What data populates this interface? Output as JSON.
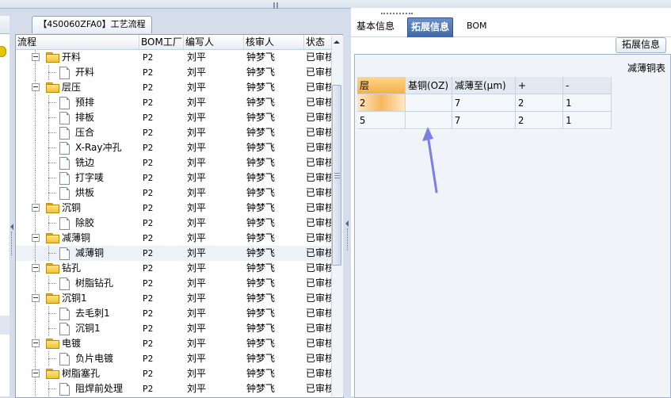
{
  "tree_tab": {
    "title": "【4S0060ZFA0】工艺流程"
  },
  "tree_grid": {
    "columns": [
      {
        "label": "流程"
      },
      {
        "label": "BOM工厂"
      },
      {
        "label": "编写人"
      },
      {
        "label": "核审人"
      },
      {
        "label": "状态"
      }
    ],
    "rows": [
      {
        "level": 0,
        "type": "folder",
        "name": "开料",
        "bom": "P2",
        "writer": "刘平",
        "reviewer": "钟梦飞",
        "status": "已审核"
      },
      {
        "level": 1,
        "type": "doc",
        "name": "开料",
        "bom": "P2",
        "writer": "刘平",
        "reviewer": "钟梦飞",
        "status": "已审核"
      },
      {
        "level": 0,
        "type": "folder",
        "name": "层压",
        "bom": "P2",
        "writer": "刘平",
        "reviewer": "钟梦飞",
        "status": "已审核"
      },
      {
        "level": 1,
        "type": "doc",
        "name": "预排",
        "bom": "P2",
        "writer": "刘平",
        "reviewer": "钟梦飞",
        "status": "已审核"
      },
      {
        "level": 1,
        "type": "doc",
        "name": "排板",
        "bom": "P2",
        "writer": "刘平",
        "reviewer": "钟梦飞",
        "status": "已审核"
      },
      {
        "level": 1,
        "type": "doc",
        "name": "压合",
        "bom": "P2",
        "writer": "刘平",
        "reviewer": "钟梦飞",
        "status": "已审核"
      },
      {
        "level": 1,
        "type": "doc",
        "name": "X-Ray冲孔",
        "bom": "P2",
        "writer": "刘平",
        "reviewer": "钟梦飞",
        "status": "已审核"
      },
      {
        "level": 1,
        "type": "doc",
        "name": "铣边",
        "bom": "P2",
        "writer": "刘平",
        "reviewer": "钟梦飞",
        "status": "已审核"
      },
      {
        "level": 1,
        "type": "doc",
        "name": "打字唛",
        "bom": "P2",
        "writer": "刘平",
        "reviewer": "钟梦飞",
        "status": "已审核"
      },
      {
        "level": 1,
        "type": "doc",
        "name": "烘板",
        "bom": "P2",
        "writer": "刘平",
        "reviewer": "钟梦飞",
        "status": "已审核"
      },
      {
        "level": 0,
        "type": "folder",
        "name": "沉铜",
        "bom": "P2",
        "writer": "刘平",
        "reviewer": "钟梦飞",
        "status": "已审核"
      },
      {
        "level": 1,
        "type": "doc",
        "name": "除胶",
        "bom": "P2",
        "writer": "刘平",
        "reviewer": "钟梦飞",
        "status": "已审核"
      },
      {
        "level": 0,
        "type": "folder",
        "name": "减薄铜",
        "bom": "P2",
        "writer": "刘平",
        "reviewer": "钟梦飞",
        "status": "已审核"
      },
      {
        "level": 1,
        "type": "doc",
        "name": "减薄铜",
        "bom": "P2",
        "writer": "刘平",
        "reviewer": "钟梦飞",
        "status": "已审核",
        "selected": true
      },
      {
        "level": 0,
        "type": "folder",
        "name": "钻孔",
        "bom": "P2",
        "writer": "刘平",
        "reviewer": "钟梦飞",
        "status": "已审核"
      },
      {
        "level": 1,
        "type": "doc",
        "name": "树脂钻孔",
        "bom": "P2",
        "writer": "刘平",
        "reviewer": "钟梦飞",
        "status": "已审核"
      },
      {
        "level": 0,
        "type": "folder",
        "name": "沉铜1",
        "bom": "P2",
        "writer": "刘平",
        "reviewer": "钟梦飞",
        "status": "已审核"
      },
      {
        "level": 1,
        "type": "doc",
        "name": "去毛刺1",
        "bom": "P2",
        "writer": "刘平",
        "reviewer": "钟梦飞",
        "status": "已审核"
      },
      {
        "level": 1,
        "type": "doc",
        "name": "沉铜1",
        "bom": "P2",
        "writer": "刘平",
        "reviewer": "钟梦飞",
        "status": "已审核"
      },
      {
        "level": 0,
        "type": "folder",
        "name": "电镀",
        "bom": "P2",
        "writer": "刘平",
        "reviewer": "钟梦飞",
        "status": "已审核"
      },
      {
        "level": 1,
        "type": "doc",
        "name": "负片电镀",
        "bom": "P2",
        "writer": "刘平",
        "reviewer": "钟梦飞",
        "status": "已审核"
      },
      {
        "level": 0,
        "type": "folder",
        "name": "树脂塞孔",
        "bom": "P2",
        "writer": "刘平",
        "reviewer": "钟梦飞",
        "status": "已审核"
      },
      {
        "level": 1,
        "type": "doc",
        "name": "阻焊前处理",
        "bom": "P2",
        "writer": "刘平",
        "reviewer": "钟梦飞",
        "status": "已审核"
      }
    ]
  },
  "right_tabs": [
    {
      "label": "基本信息",
      "active": false
    },
    {
      "label": "拓展信息",
      "active": true
    },
    {
      "label": "BOM",
      "active": false
    }
  ],
  "ext_panel": {
    "button_label": "拓展信息",
    "table_title": "减薄铜表",
    "columns": [
      "层",
      "基铜(OZ)",
      "减薄至(μm)",
      "+",
      "-"
    ],
    "rows": [
      {
        "layer": "2",
        "base_copper": "",
        "thin_to": "7",
        "plus": "2",
        "minus": "1",
        "selected": true
      },
      {
        "layer": "5",
        "base_copper": "",
        "thin_to": "7",
        "plus": "2",
        "minus": "1",
        "selected": false
      }
    ]
  },
  "colors": {
    "accent_tab": "#3e67a8",
    "annotation_arrow": "#7b7fe6",
    "folder": "#f1c232"
  }
}
